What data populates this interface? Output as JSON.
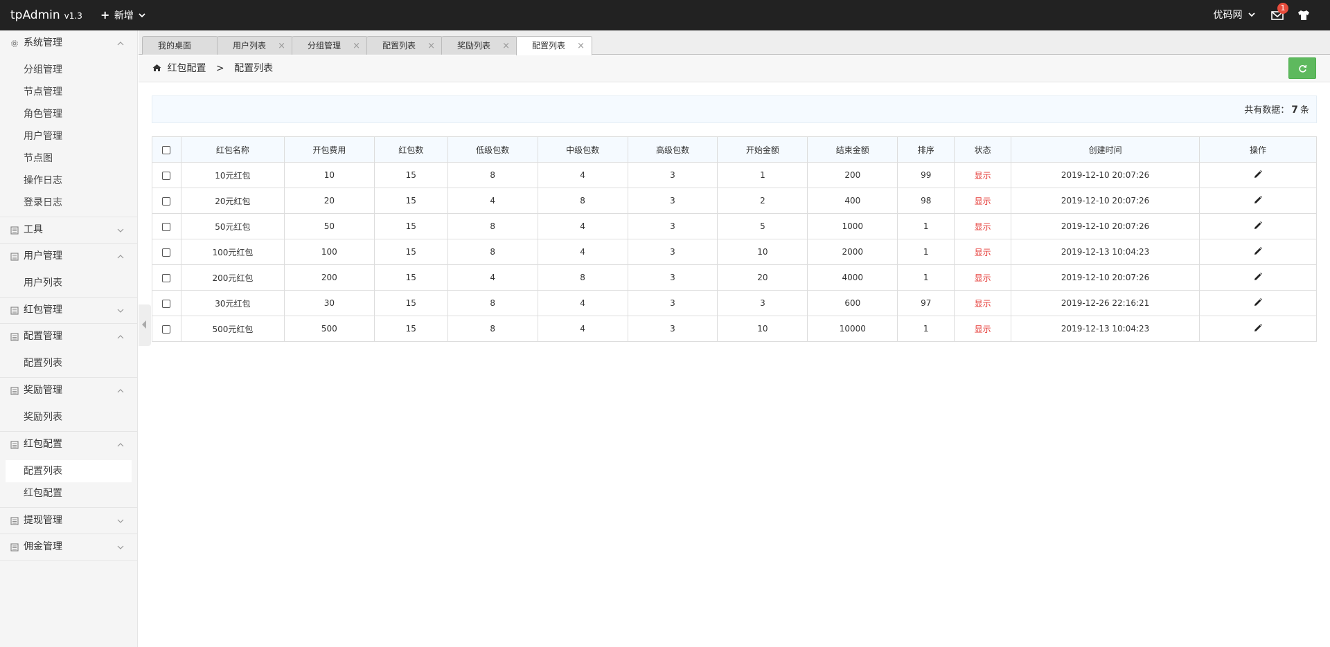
{
  "topbar": {
    "brand": "tpAdmin",
    "version": "v1.3",
    "new_label": "新增",
    "site_label": "优码网",
    "notification_count": "1"
  },
  "sidebar": {
    "groups": [
      {
        "title": "系统管理",
        "expanded": true,
        "items": [
          "分组管理",
          "节点管理",
          "角色管理",
          "用户管理",
          "节点图",
          "操作日志",
          "登录日志"
        ]
      },
      {
        "title": "工具",
        "expanded": false,
        "items": []
      },
      {
        "title": "用户管理",
        "expanded": true,
        "items": [
          "用户列表"
        ]
      },
      {
        "title": "红包管理",
        "expanded": false,
        "items": []
      },
      {
        "title": "配置管理",
        "expanded": true,
        "items": [
          "配置列表"
        ]
      },
      {
        "title": "奖励管理",
        "expanded": true,
        "items": [
          "奖励列表"
        ]
      },
      {
        "title": "红包配置",
        "expanded": true,
        "items": [
          "配置列表",
          "红包配置"
        ]
      },
      {
        "title": "提现管理",
        "expanded": false,
        "items": []
      },
      {
        "title": "佣金管理",
        "expanded": false,
        "items": []
      }
    ],
    "active_item": "配置列表"
  },
  "tabs": [
    {
      "label": "我的桌面",
      "closable": false
    },
    {
      "label": "用户列表",
      "closable": true
    },
    {
      "label": "分组管理",
      "closable": true
    },
    {
      "label": "配置列表",
      "closable": true
    },
    {
      "label": "奖励列表",
      "closable": true
    },
    {
      "label": "配置列表",
      "closable": true,
      "active": true
    }
  ],
  "breadcrumb": {
    "parent": "红包配置",
    "separator": ">",
    "current": "配置列表"
  },
  "count": {
    "prefix": "共有数据：",
    "value": "7",
    "suffix": "条"
  },
  "table": {
    "headers": [
      "红包名称",
      "开包费用",
      "红包数",
      "低级包数",
      "中级包数",
      "高级包数",
      "开始金额",
      "结束金额",
      "排序",
      "状态",
      "创建时间",
      "操作"
    ],
    "rows": [
      [
        "10元红包",
        "10",
        "15",
        "8",
        "4",
        "3",
        "1",
        "200",
        "99",
        "显示",
        "2019-12-10 20:07:26"
      ],
      [
        "20元红包",
        "20",
        "15",
        "4",
        "8",
        "3",
        "2",
        "400",
        "98",
        "显示",
        "2019-12-10 20:07:26"
      ],
      [
        "50元红包",
        "50",
        "15",
        "8",
        "4",
        "3",
        "5",
        "1000",
        "1",
        "显示",
        "2019-12-10 20:07:26"
      ],
      [
        "100元红包",
        "100",
        "15",
        "8",
        "4",
        "3",
        "10",
        "2000",
        "1",
        "显示",
        "2019-12-13 10:04:23"
      ],
      [
        "200元红包",
        "200",
        "15",
        "4",
        "8",
        "3",
        "20",
        "4000",
        "1",
        "显示",
        "2019-12-10 20:07:26"
      ],
      [
        "30元红包",
        "30",
        "15",
        "8",
        "4",
        "3",
        "3",
        "600",
        "97",
        "显示",
        "2019-12-26 22:16:21"
      ],
      [
        "500元红包",
        "500",
        "15",
        "8",
        "4",
        "3",
        "10",
        "10000",
        "1",
        "显示",
        "2019-12-13 10:04:23"
      ]
    ]
  },
  "colors": {
    "topbar_bg": "#222222",
    "status_red": "#e53935",
    "refresh_green": "#5eb95e",
    "active_link": "#1e88e5"
  }
}
